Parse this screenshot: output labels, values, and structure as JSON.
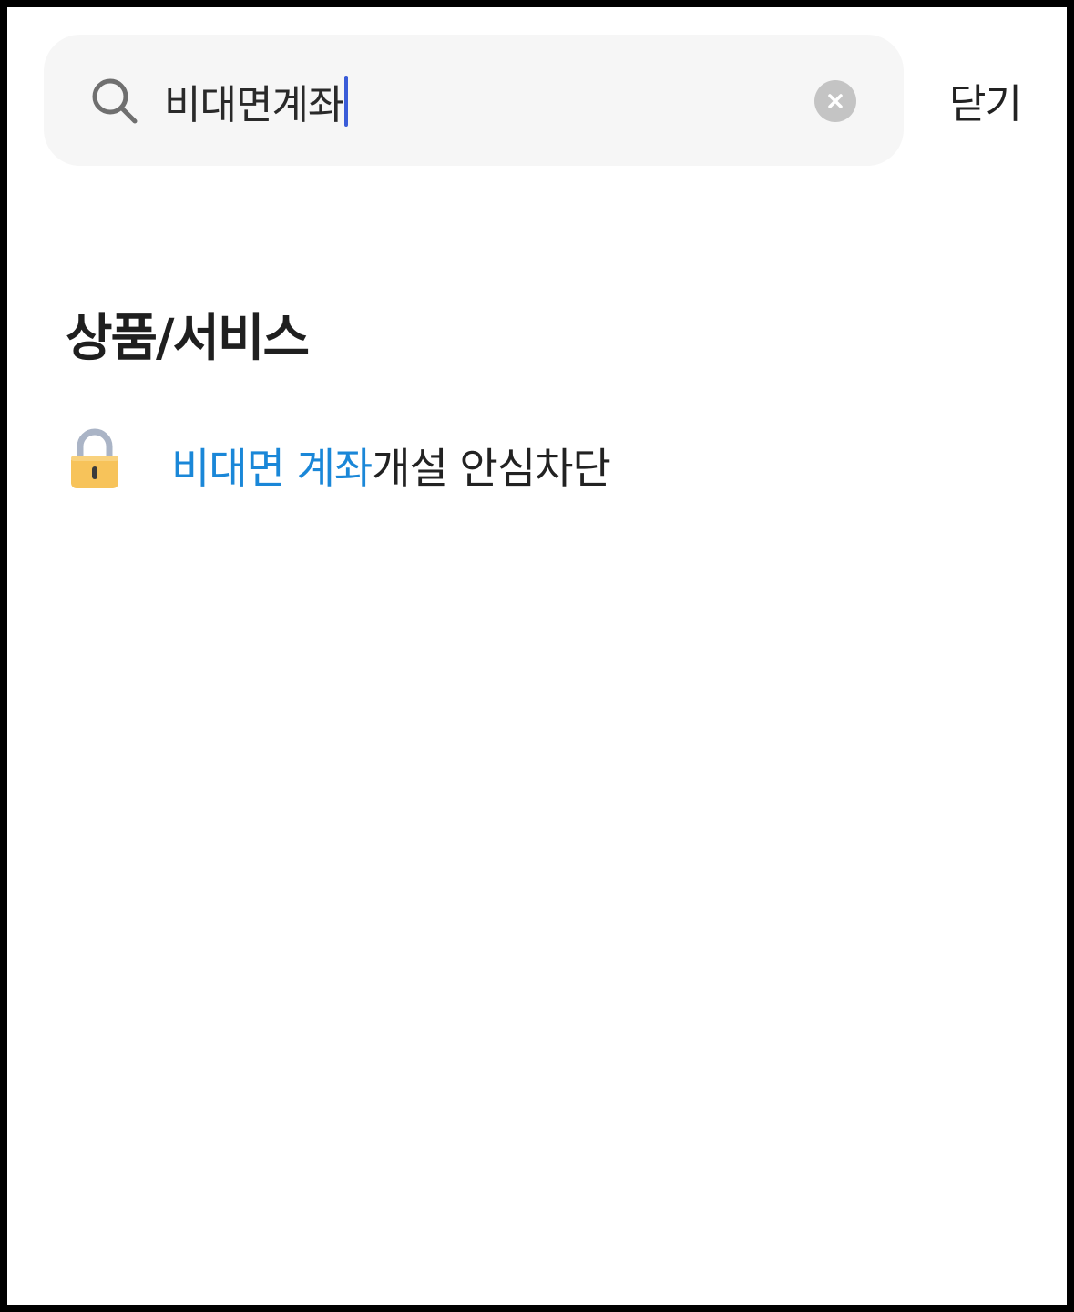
{
  "search": {
    "query": "비대면계좌",
    "clear_icon": "close-circle-icon",
    "search_icon": "search-icon"
  },
  "header": {
    "close_label": "닫기"
  },
  "results": {
    "section_title": "상품/서비스",
    "items": [
      {
        "icon": "lock-icon",
        "highlight_text": "비대면 계좌",
        "rest_text": "개설 안심차단"
      }
    ]
  },
  "colors": {
    "highlight": "#1a87d8",
    "caret": "#3a5cd8",
    "search_bg": "#f6f6f6"
  }
}
